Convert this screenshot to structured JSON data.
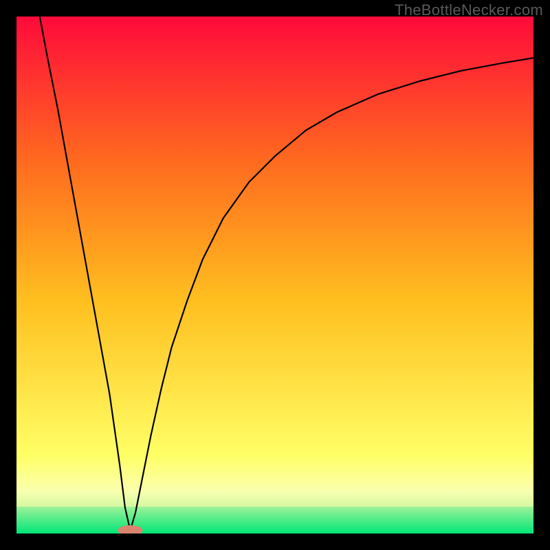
{
  "watermark": "TheBottleNecker.com",
  "colors": {
    "top": "#ff0a3a",
    "mid1": "#ff6a1f",
    "mid2": "#ffd21f",
    "mid3": "#ffff66",
    "band_pale": "#faffb0",
    "bottom": "#00e676",
    "curve": "#000000",
    "marker": "#d9846e"
  },
  "chart_data": {
    "type": "line",
    "title": "",
    "xlabel": "",
    "ylabel": "",
    "xlim": [
      0,
      100
    ],
    "ylim": [
      0,
      100
    ],
    "marker": {
      "x": 22,
      "y": 0.6,
      "rx": 2.4,
      "ry": 1.0
    },
    "curve": [
      {
        "x": 4.5,
        "y": 100
      },
      {
        "x": 6,
        "y": 92
      },
      {
        "x": 8,
        "y": 82
      },
      {
        "x": 10,
        "y": 71
      },
      {
        "x": 12,
        "y": 60
      },
      {
        "x": 14,
        "y": 49
      },
      {
        "x": 16,
        "y": 38
      },
      {
        "x": 18,
        "y": 27
      },
      {
        "x": 20,
        "y": 13
      },
      {
        "x": 21,
        "y": 5
      },
      {
        "x": 22,
        "y": 0.6
      },
      {
        "x": 23,
        "y": 4
      },
      {
        "x": 24,
        "y": 9
      },
      {
        "x": 26,
        "y": 19
      },
      {
        "x": 28,
        "y": 28
      },
      {
        "x": 30,
        "y": 36
      },
      {
        "x": 33,
        "y": 45
      },
      {
        "x": 36,
        "y": 53
      },
      {
        "x": 40,
        "y": 61
      },
      {
        "x": 45,
        "y": 68
      },
      {
        "x": 50,
        "y": 73
      },
      {
        "x": 56,
        "y": 78
      },
      {
        "x": 62,
        "y": 81.5
      },
      {
        "x": 70,
        "y": 85
      },
      {
        "x": 78,
        "y": 87.5
      },
      {
        "x": 86,
        "y": 89.5
      },
      {
        "x": 94,
        "y": 91
      },
      {
        "x": 100,
        "y": 92
      }
    ],
    "gradient_bands": [
      {
        "y0": 0,
        "y1": 5.2,
        "c0": "#00e676",
        "c1": "#9df29a"
      },
      {
        "y0": 5.2,
        "y1": 8,
        "c0": "#d7f7a0",
        "c1": "#f6ffb0"
      },
      {
        "y0": 8,
        "y1": 15,
        "c0": "#faffb0",
        "c1": "#ffff66"
      },
      {
        "y0": 15,
        "y1": 45,
        "c0": "#ffff66",
        "c1": "#ffbf1f"
      },
      {
        "y0": 45,
        "y1": 72,
        "c0": "#ffbf1f",
        "c1": "#ff6a1f"
      },
      {
        "y0": 72,
        "y1": 100,
        "c0": "#ff6a1f",
        "c1": "#ff0a3a"
      }
    ]
  }
}
